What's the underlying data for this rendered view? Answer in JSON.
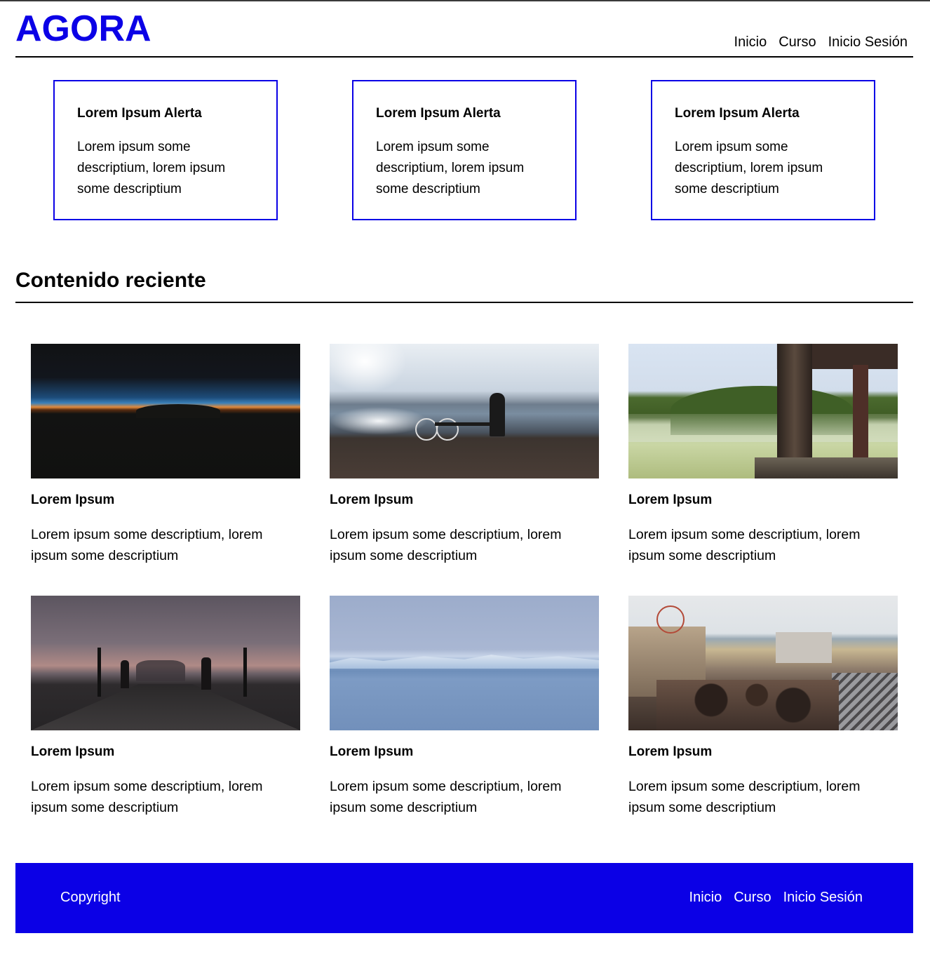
{
  "header": {
    "logo": "AGORA",
    "nav": [
      "Inicio",
      "Curso",
      "Inicio Sesión"
    ]
  },
  "alerts": [
    {
      "title": "Lorem Ipsum Alerta",
      "text": "Lorem ipsum some descriptium, lorem ipsum some descriptium"
    },
    {
      "title": "Lorem Ipsum Alerta",
      "text": "Lorem ipsum some descriptium, lorem ipsum some descriptium"
    },
    {
      "title": "Lorem Ipsum Alerta",
      "text": "Lorem ipsum some descriptium, lorem ipsum some descriptium"
    }
  ],
  "recent": {
    "title": "Contenido reciente",
    "items": [
      {
        "title": "Lorem Ipsum",
        "text": "Lorem ipsum some descriptium, lorem ipsum some descriptium",
        "image": "sunset-horizon-photo"
      },
      {
        "title": "Lorem Ipsum",
        "text": "Lorem ipsum some descriptium, lorem ipsum some descriptium",
        "image": "lake-bicycle-photo"
      },
      {
        "title": "Lorem Ipsum",
        "text": "Lorem ipsum some descriptium, lorem ipsum some descriptium",
        "image": "misty-lake-pier-photo"
      },
      {
        "title": "Lorem Ipsum",
        "text": "Lorem ipsum some descriptium, lorem ipsum some descriptium",
        "image": "bridge-dusk-photo"
      },
      {
        "title": "Lorem Ipsum",
        "text": "Lorem ipsum some descriptium, lorem ipsum some descriptium",
        "image": "glacier-water-photo"
      },
      {
        "title": "Lorem Ipsum",
        "text": "Lorem ipsum some descriptium, lorem ipsum some descriptium",
        "image": "boardwalk-crowd-photo"
      }
    ]
  },
  "footer": {
    "copyright": "Copyright",
    "nav": [
      "Inicio",
      "Curso",
      "Inicio Sesión"
    ]
  },
  "colors": {
    "brand": "#0b00e6",
    "text": "#000000",
    "background": "#ffffff"
  }
}
